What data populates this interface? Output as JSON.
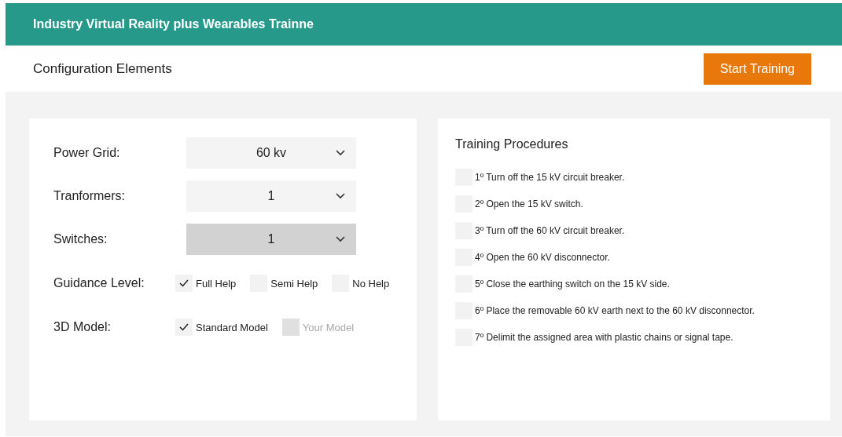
{
  "header": {
    "title": "Industry Virtual Reality plus Wearables Trainne"
  },
  "subheader": {
    "title": "Configuration Elements",
    "button": "Start Training"
  },
  "config": {
    "selects": [
      {
        "label": "Power Grid:",
        "value": "60 kv",
        "highlighted": false
      },
      {
        "label": "Tranformers:",
        "value": "1",
        "highlighted": false
      },
      {
        "label": "Switches:",
        "value": "1",
        "highlighted": true
      }
    ],
    "options": [
      {
        "label": "Guidance Level:",
        "choices": [
          {
            "label": "Full Help",
            "checked": true,
            "disabled": false
          },
          {
            "label": "Semi Help",
            "checked": false,
            "disabled": false
          },
          {
            "label": "No Help",
            "checked": false,
            "disabled": false
          }
        ]
      },
      {
        "label": "3D Model:",
        "choices": [
          {
            "label": "Standard Model",
            "checked": true,
            "disabled": false
          },
          {
            "label": "Your Model",
            "checked": false,
            "disabled": true
          }
        ]
      }
    ]
  },
  "procedures": {
    "title": "Training Procedures",
    "steps": [
      {
        "text": "1º Turn off the 15 kV circuit breaker.",
        "checked": false
      },
      {
        "text": "2º Open the 15 kV switch.",
        "checked": false
      },
      {
        "text": "3º Turn off the 60 kV circuit breaker.",
        "checked": false
      },
      {
        "text": "4º Open the 60 kV disconnector.",
        "checked": false
      },
      {
        "text": "5º Close the earthing switch on the 15 kV side.",
        "checked": false
      },
      {
        "text": "6º Place the removable 60 kV earth next to the 60 kV disconnector.",
        "checked": false
      },
      {
        "text": "7º Delimit the assigned area with plastic chains or signal tape.",
        "checked": false
      }
    ]
  }
}
